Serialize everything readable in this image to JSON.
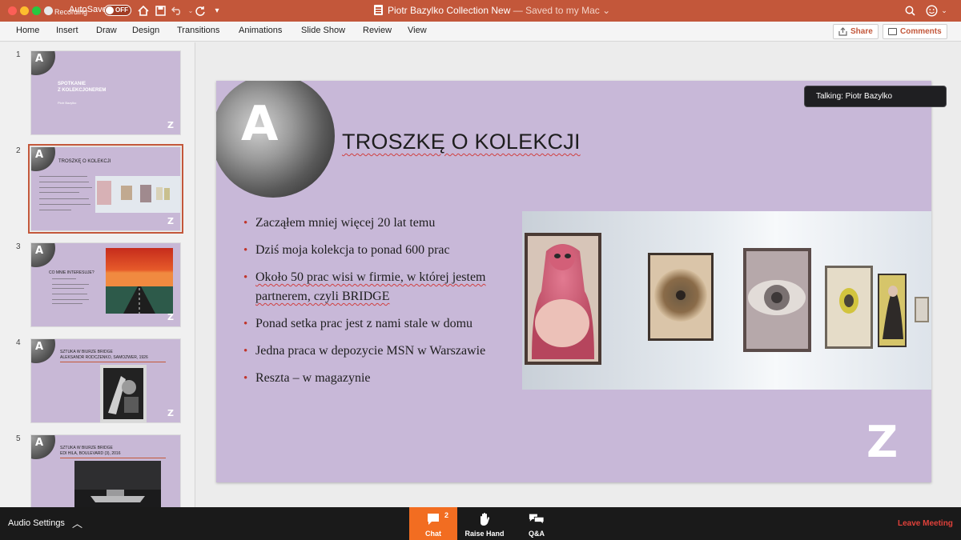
{
  "titlebar": {
    "recording": "Recording",
    "autosave_label": "AutoSave",
    "autosave_state": "OFF",
    "document_name": "Piotr Bazylko Collection New",
    "save_status": " — Saved to my Mac",
    "accent": "#c3573a"
  },
  "ribbon": {
    "tabs": [
      "Home",
      "Insert",
      "Draw",
      "Design",
      "Transitions",
      "Animations",
      "Slide Show",
      "Review",
      "View"
    ],
    "share_label": "Share",
    "comments_label": "Comments"
  },
  "thumbnails": [
    {
      "number": "1",
      "title_line1": "SPOTKANIE",
      "title_line2": "Z KOLEKCJONEREM",
      "subtitle": "Piotr Bazylko"
    },
    {
      "number": "2",
      "title": "TROSZKĘ O KOLEKCJI",
      "selected": true
    },
    {
      "number": "3",
      "title": "CO MNIE INTERESUJE?"
    },
    {
      "number": "4",
      "title_line1": "SZTUKA W BIURZE BRIDGE",
      "title_line2": "ALEKSANDR RODCZENKO, SAMOZWER, 1926"
    },
    {
      "number": "5",
      "title_line1": "SZTUKA W BIURZE BRIDGE",
      "title_line2": "EDI HILA, BOULEVARD (3), 2016"
    }
  ],
  "slide": {
    "logo_letter": "A",
    "brand_letter": "Z",
    "title": "TROSZKĘ O KOLEKCJI",
    "bullets": [
      "Zacząłem mniej więcej 20 lat temu",
      "Dziś moja kolekcja to ponad 600 prac",
      "Około 50 prac wisi w firmie, w której jestem partnerem, czyli BRIDGE",
      "Ponad setka prac jest z nami stale w domu",
      "Jedna praca w depozycie MSN w Warszawie",
      "Reszta – w magazynie"
    ],
    "background": "#c8b8d8"
  },
  "talking_indicator": "Talking: Piotr Bazylko",
  "meeting_bar": {
    "audio_settings": "Audio Settings",
    "chat_label": "Chat",
    "chat_badge": "2",
    "raise_hand_label": "Raise Hand",
    "qa_label": "Q&A",
    "leave_label": "Leave Meeting",
    "chat_color": "#f26d21",
    "leave_color": "#e0413a"
  }
}
